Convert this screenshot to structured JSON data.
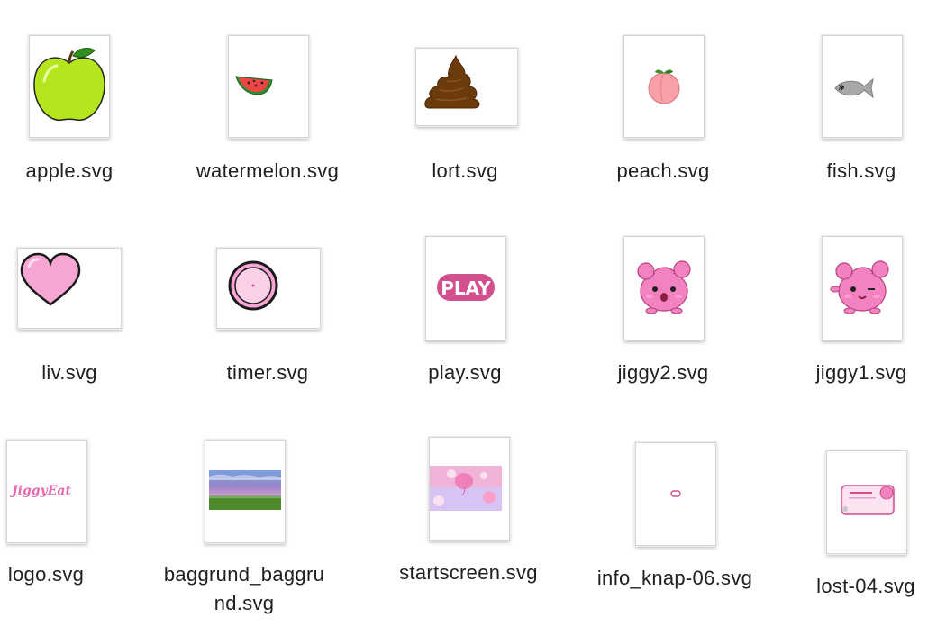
{
  "files": [
    {
      "name": "apple.svg",
      "icon": "apple-icon"
    },
    {
      "name": "watermelon.svg",
      "icon": "watermelon-icon"
    },
    {
      "name": "lort.svg",
      "icon": "poop-icon"
    },
    {
      "name": "peach.svg",
      "icon": "peach-icon"
    },
    {
      "name": "fish.svg",
      "icon": "fish-icon"
    },
    {
      "name": "liv.svg",
      "icon": "heart-icon"
    },
    {
      "name": "timer.svg",
      "icon": "timer-icon"
    },
    {
      "name": "play.svg",
      "icon": "play-button-icon"
    },
    {
      "name": "jiggy2.svg",
      "icon": "jiggy-surprised-icon"
    },
    {
      "name": "jiggy1.svg",
      "icon": "jiggy-wink-icon"
    },
    {
      "name": "logo.svg",
      "icon": "logo-icon",
      "logo_text": "JiggyEat"
    },
    {
      "name": "baggrund_baggru",
      "name_line2": "nd.svg",
      "icon": "background-landscape-icon"
    },
    {
      "name": "startscreen.svg",
      "icon": "startscreen-icon"
    },
    {
      "name": "info_knap-06.svg",
      "icon": "info-button-icon"
    },
    {
      "name": "lost-04.svg",
      "icon": "lost-screen-icon"
    }
  ],
  "play_text": "PLAY",
  "colors": {
    "pink": "#f7a6d4",
    "dark_pink": "#d2508e",
    "apple_green": "#b5e61d",
    "poop_brown": "#6b3b0b",
    "fish_gray": "#a8a8a8"
  }
}
